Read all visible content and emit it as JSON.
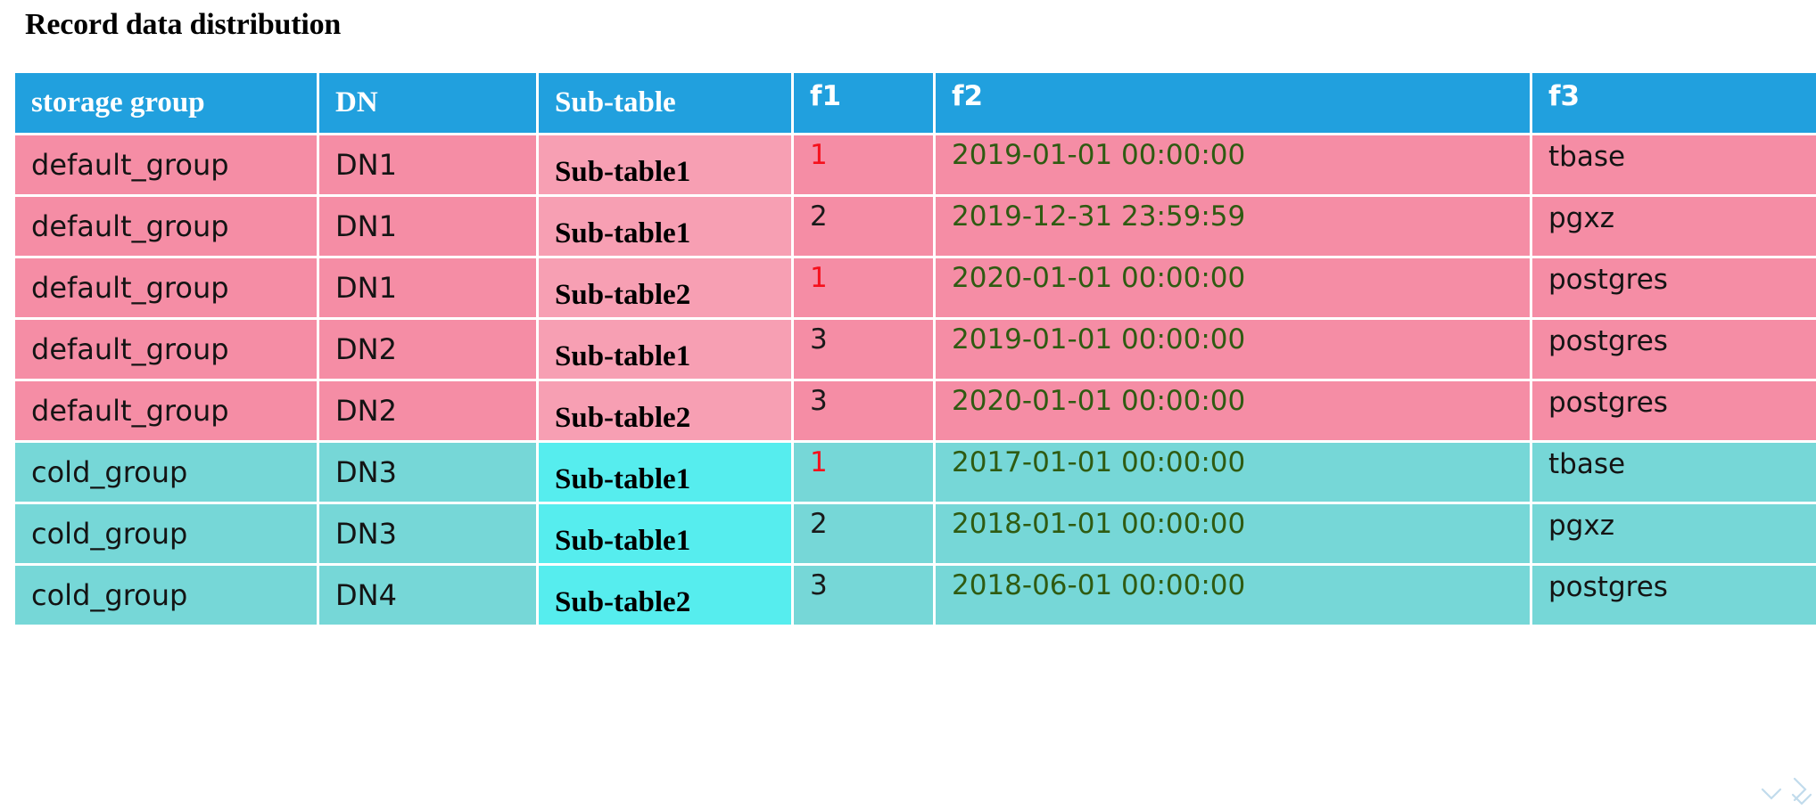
{
  "page": {
    "title": "Record data distribution",
    "background_color": "#ffffff"
  },
  "theme": {
    "header_blue": "#21A0DE",
    "hot_row_pink": "#F58DA5",
    "hot_subtable_pink": "#F79FB3",
    "cold_row_teal": "#76D7D7",
    "cold_subtable_cyan": "#56EDEE",
    "highlight_red": "#F5101C",
    "timestamp_green": "#2F5B12",
    "grid_line_white": "#FFFFFF"
  },
  "table": {
    "columns": [
      {
        "key": "storage_group",
        "label": "storage group",
        "style": "serif"
      },
      {
        "key": "dn",
        "label": "DN",
        "style": "serif"
      },
      {
        "key": "sub_table",
        "label": "Sub-table",
        "style": "serif"
      },
      {
        "key": "f1",
        "label": "f1",
        "style": "sans"
      },
      {
        "key": "f2",
        "label": "f2",
        "style": "sans"
      },
      {
        "key": "f3",
        "label": "f3",
        "style": "sans"
      }
    ],
    "rows": [
      {
        "group_kind": "hot",
        "storage_group": "default_group",
        "dn": "DN1",
        "sub_table": "Sub-table1",
        "f1": "1",
        "f1_highlight": true,
        "f2": "2019-01-01 00:00:00",
        "f3": "tbase"
      },
      {
        "group_kind": "hot",
        "storage_group": "default_group",
        "dn": "DN1",
        "sub_table": "Sub-table1",
        "f1": "2",
        "f1_highlight": false,
        "f2": "2019-12-31 23:59:59",
        "f3": "pgxz"
      },
      {
        "group_kind": "hot",
        "storage_group": "default_group",
        "dn": "DN1",
        "sub_table": "Sub-table2",
        "f1": "1",
        "f1_highlight": true,
        "f2": "2020-01-01 00:00:00",
        "f3": "postgres"
      },
      {
        "group_kind": "hot",
        "storage_group": "default_group",
        "dn": "DN2",
        "sub_table": "Sub-table1",
        "f1": "3",
        "f1_highlight": false,
        "f2": "2019-01-01 00:00:00",
        "f3": "postgres"
      },
      {
        "group_kind": "hot",
        "storage_group": "default_group",
        "dn": "DN2",
        "sub_table": "Sub-table2",
        "f1": "3",
        "f1_highlight": false,
        "f2": "2020-01-01 00:00:00",
        "f3": "postgres"
      },
      {
        "group_kind": "cold",
        "storage_group": "cold_group",
        "dn": "DN3",
        "sub_table": "Sub-table1",
        "f1": "1",
        "f1_highlight": true,
        "f2": "2017-01-01 00:00:00",
        "f3": "tbase"
      },
      {
        "group_kind": "cold",
        "storage_group": "cold_group",
        "dn": "DN3",
        "sub_table": "Sub-table1",
        "f1": "2",
        "f1_highlight": false,
        "f2": "2018-01-01 00:00:00",
        "f3": "pgxz"
      },
      {
        "group_kind": "cold",
        "storage_group": "cold_group",
        "dn": "DN4",
        "sub_table": "Sub-table2",
        "f1": "3",
        "f1_highlight": false,
        "f2": "2018-06-01 00:00:00",
        "f3": "postgres"
      }
    ]
  },
  "decoration": {
    "corner_mark": "chevron-cross-mark"
  }
}
